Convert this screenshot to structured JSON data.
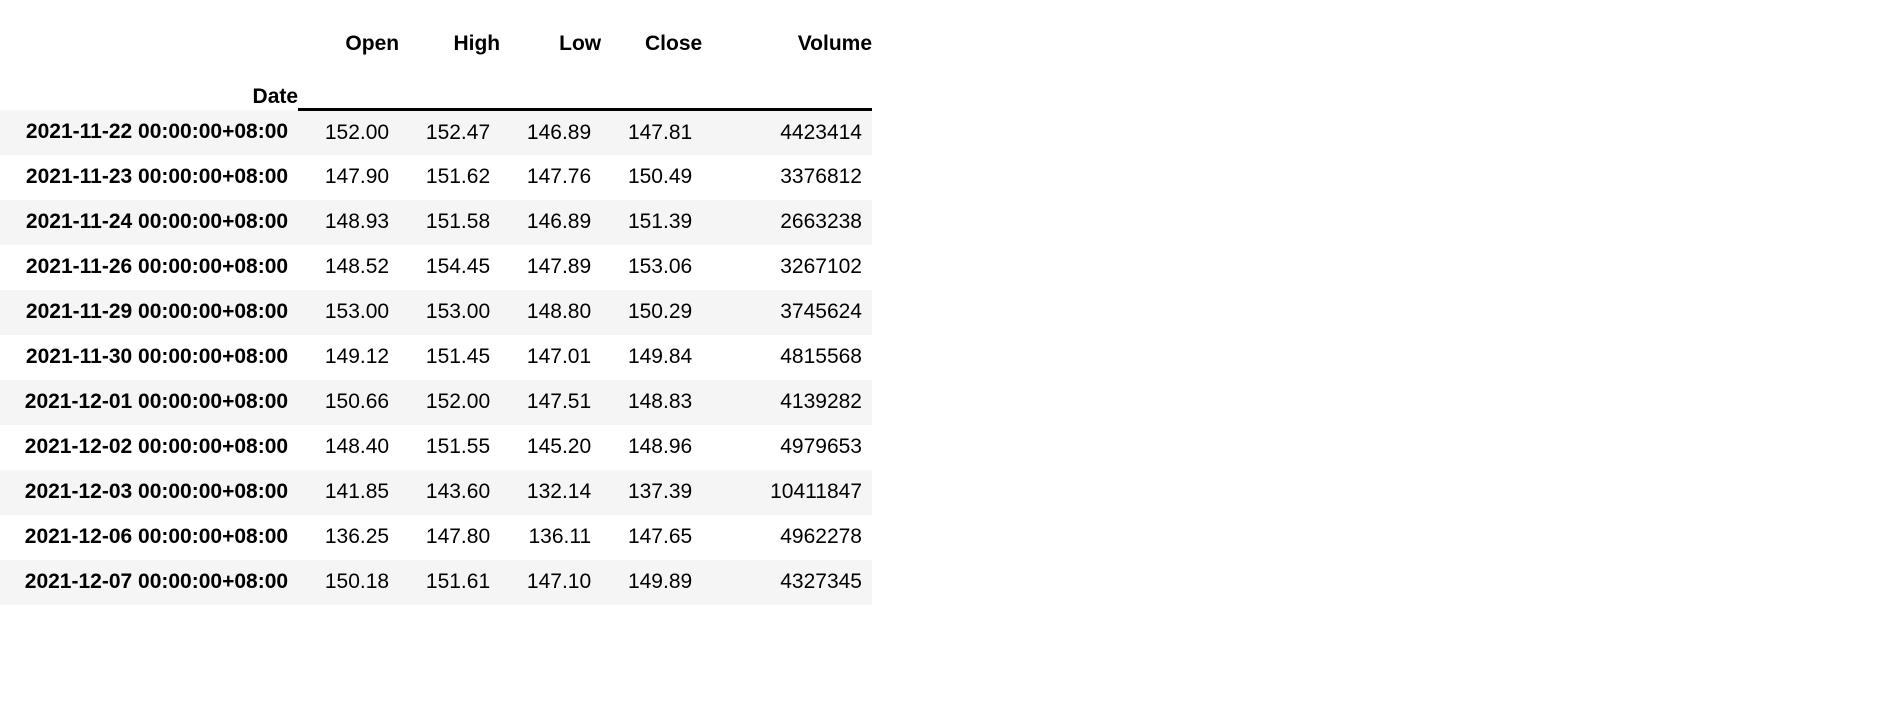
{
  "table": {
    "index_name": "Date",
    "columns": [
      "Open",
      "High",
      "Low",
      "Close",
      "Volume"
    ],
    "rows": [
      {
        "index": "2021-11-22 00:00:00+08:00",
        "open": "152.00",
        "high": "152.47",
        "low": "146.89",
        "close": "147.81",
        "volume": "4423414"
      },
      {
        "index": "2021-11-23 00:00:00+08:00",
        "open": "147.90",
        "high": "151.62",
        "low": "147.76",
        "close": "150.49",
        "volume": "3376812"
      },
      {
        "index": "2021-11-24 00:00:00+08:00",
        "open": "148.93",
        "high": "151.58",
        "low": "146.89",
        "close": "151.39",
        "volume": "2663238"
      },
      {
        "index": "2021-11-26 00:00:00+08:00",
        "open": "148.52",
        "high": "154.45",
        "low": "147.89",
        "close": "153.06",
        "volume": "3267102"
      },
      {
        "index": "2021-11-29 00:00:00+08:00",
        "open": "153.00",
        "high": "153.00",
        "low": "148.80",
        "close": "150.29",
        "volume": "3745624"
      },
      {
        "index": "2021-11-30 00:00:00+08:00",
        "open": "149.12",
        "high": "151.45",
        "low": "147.01",
        "close": "149.84",
        "volume": "4815568"
      },
      {
        "index": "2021-12-01 00:00:00+08:00",
        "open": "150.66",
        "high": "152.00",
        "low": "147.51",
        "close": "148.83",
        "volume": "4139282"
      },
      {
        "index": "2021-12-02 00:00:00+08:00",
        "open": "148.40",
        "high": "151.55",
        "low": "145.20",
        "close": "148.96",
        "volume": "4979653"
      },
      {
        "index": "2021-12-03 00:00:00+08:00",
        "open": "141.85",
        "high": "143.60",
        "low": "132.14",
        "close": "137.39",
        "volume": "10411847"
      },
      {
        "index": "2021-12-06 00:00:00+08:00",
        "open": "136.25",
        "high": "147.80",
        "low": "136.11",
        "close": "147.65",
        "volume": "4962278"
      },
      {
        "index": "2021-12-07 00:00:00+08:00",
        "open": "150.18",
        "high": "151.61",
        "low": "147.10",
        "close": "149.89",
        "volume": "4327345"
      }
    ]
  },
  "colors": {
    "stripe": "#f5f5f5",
    "background": "#ffffff",
    "text": "#000000",
    "rule": "#000000"
  }
}
